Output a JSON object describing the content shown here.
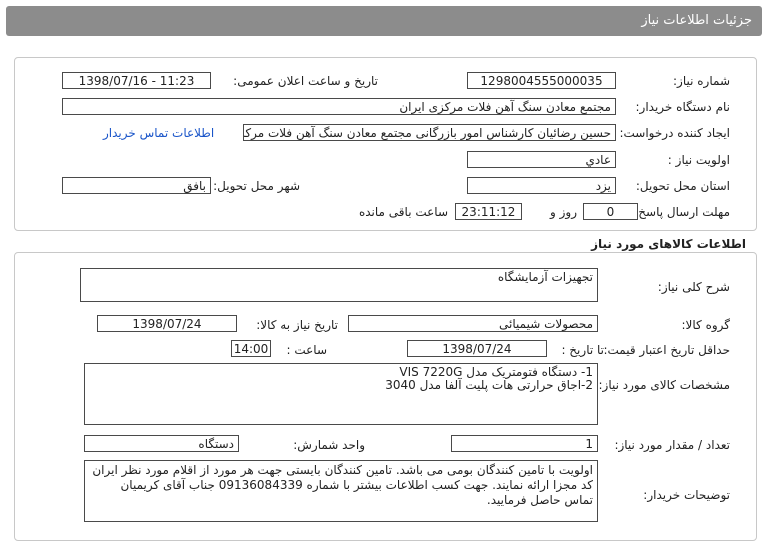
{
  "header": {
    "title": "جزئیات اطلاعات نیاز"
  },
  "need_info": {
    "need_number": {
      "label": "شماره نیاز:",
      "value": "1298004555000035"
    },
    "announce_datetime": {
      "label": "تاریخ و ساعت اعلان عمومی:",
      "value": "1398/07/16 - 11:23"
    },
    "buyer_org": {
      "label": "نام دستگاه خریدار:",
      "value": "مجتمع معادن سنگ آهن فلات مرکزی ایران"
    },
    "requester": {
      "label": "ایجاد کننده درخواست:",
      "value": "حسین رضائیان کارشناس امور بازرگانی مجتمع معادن سنگ آهن فلات مرکزی ایران",
      "contact_link": "اطلاعات تماس خریدار"
    },
    "priority": {
      "label": "اولویت نیاز :",
      "value": "عادي"
    },
    "province": {
      "label": "استان محل تحویل:",
      "value": "یزد"
    },
    "city": {
      "label": "شهر محل تحویل:",
      "value": "بافق"
    },
    "deadline": {
      "label": "مهلت ارسال پاسخ:",
      "days": "0",
      "days_unit": "روز و",
      "time": "23:11:12",
      "remaining": "ساعت باقی مانده"
    }
  },
  "goods": {
    "section_title": "اطلاعات کالاهای مورد نیاز",
    "general_desc": {
      "label": "شرح کلی نیاز:",
      "value": "تجهیزات آزمایشگاه"
    },
    "goods_group": {
      "label": "گروه کالا:",
      "value": "محصولات شیمیائی"
    },
    "need_date": {
      "label": "تاریخ نیاز به کالا:",
      "value": "1398/07/24"
    },
    "price_validity": {
      "label": "حداقل تاریخ اعتبار قیمت:",
      "to_date_label": "تا تاریخ :",
      "date": "1398/07/24",
      "time_label": "ساعت :",
      "time": "14:00"
    },
    "specs": {
      "label": "مشخصات کالای مورد نیاز:",
      "line1": "1- دستگاه فتومتریک مدل VIS  7220G",
      "line2": "2-اجاق حرارتی هات پلیت آلفا مدل 3040"
    },
    "quantity": {
      "label": "تعداد / مقدار مورد نیاز:",
      "value": "1"
    },
    "unit": {
      "label": "واحد شمارش:",
      "value": "دستگاه"
    },
    "buyer_notes": {
      "label": "توضیحات خریدار:",
      "value": "اولویت با تامین کنندگان بومی می باشد. تامین کنندگان بایستی جهت هر مورد از اقلام مورد نظر  ایران کد مجزا ارائه نمایند. جهت کسب اطلاعات بیشتر با شماره 09136084339 جناب آقای کریمیان تماس حاصل فرمایید."
    }
  }
}
